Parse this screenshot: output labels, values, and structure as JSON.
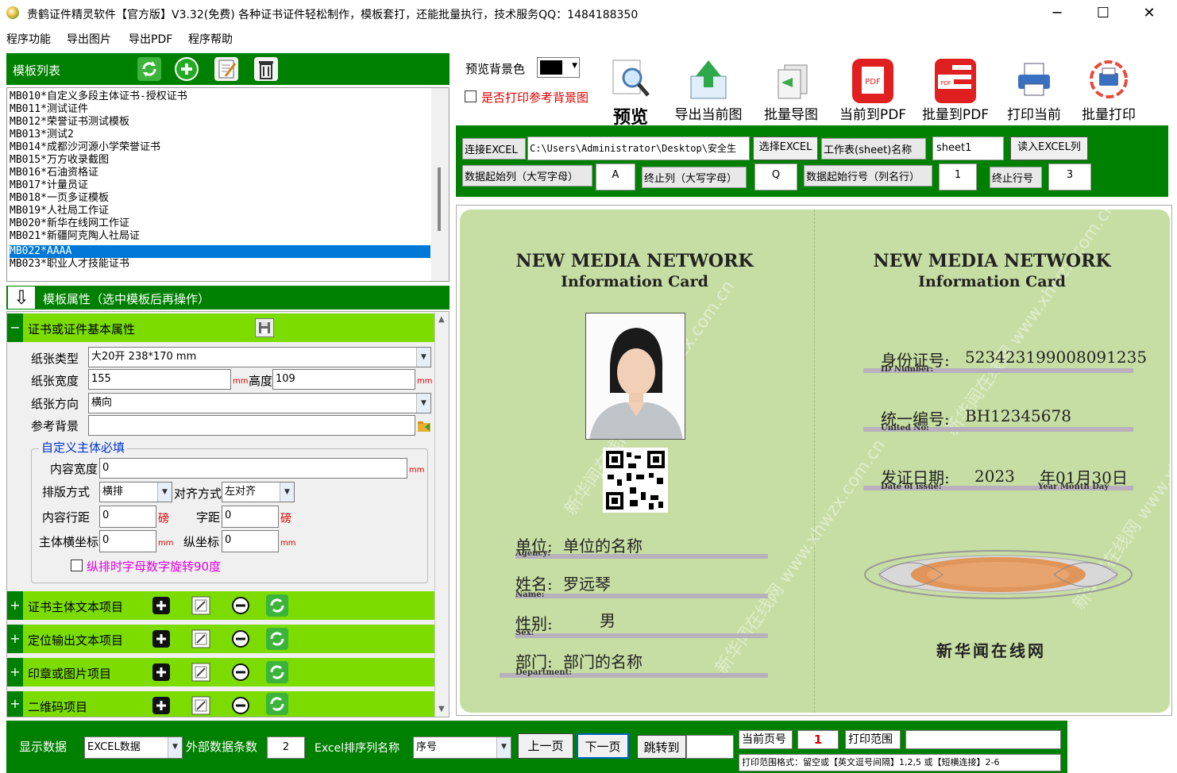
{
  "window": {
    "title": "贵鹤证件精灵软件【官方版】V3.32(免费)    各种证书证件轻松制作，模板套打，还能批量执行，技术服务QQ：1484188350",
    "minimize": "─",
    "maximize": "☐",
    "close": "✕"
  },
  "menu": [
    "程序功能",
    "导出图片",
    "导出PDF",
    "程序帮助"
  ],
  "template_list": {
    "title": "模板列表",
    "items": [
      "MB010*自定义多段主体证书-授权证书",
      "MB011*测试证件",
      "MB012*荣誉证书测试模板",
      "MB013*测试2",
      "MB014*成都沙河源小学荣誉证书",
      "MB015*万方收录截图",
      "MB016*石油资格证",
      "MB017*计量员证",
      "MB018*一页多证模板",
      "MB019*人社局工作证",
      "MB020*新华在线网工作证",
      "MB021*新疆阿克陶人社局证",
      "MB022*AAAA",
      "MB023*职业人才技能证书"
    ],
    "selected_index": 12
  },
  "props": {
    "header": "模板属性（选中模板后再操作）",
    "basic_section": "证书或证件基本属性",
    "paper_type_label": "纸张类型",
    "paper_type_value": "大20开 238*170 mm",
    "width_label": "纸张宽度",
    "width_value": "155",
    "height_label": "高度",
    "height_value": "109",
    "unit_mm": "mm",
    "orientation_label": "纸张方向",
    "orientation_value": "横向",
    "ref_bg_label": "参考背景",
    "ref_bg_value": "",
    "custom_group_title": "自定义主体必填",
    "content_width_label": "内容宽度",
    "content_width_value": "0",
    "layout_label": "排版方式",
    "layout_value": "横排",
    "align_label": "对齐方式",
    "align_value": "左对齐",
    "line_spacing_label": "内容行距",
    "line_spacing_value": "0",
    "unit_pound": "磅",
    "char_spacing_label": "字距",
    "char_spacing_value": "0",
    "x_label": "主体横坐标",
    "x_value": "0",
    "y_label": "纵坐标",
    "y_value": "0",
    "rotate_label": "纵排时字母数字旋转90度",
    "sections": [
      "证书主体文本项目",
      "定位输出文本项目",
      "印章或图片项目",
      "二维码项目"
    ]
  },
  "toolbar": {
    "bg_color_label": "预览背景色",
    "print_ref_label": "是否打印参考背景图",
    "buttons": [
      "预览",
      "导出当前图",
      "批量导图",
      "当前到PDF",
      "批量到PDF",
      "打印当前",
      "批量打印"
    ]
  },
  "excel": {
    "connect_label": "连接EXCEL",
    "path": "C:\\Users\\Administrator\\Desktop\\安全生",
    "select_btn": "选择EXCEL",
    "sheet_label": "工作表(sheet)名称",
    "sheet_value": "sheet1",
    "read_btn": "读入EXCEL列",
    "start_col_label": "数据起始列（大写字母）",
    "start_col_value": "A",
    "end_col_label": "终止列（大写字母）",
    "end_col_value": "Q",
    "start_row_label": "数据起始行号（列名行）",
    "start_row_value": "1",
    "end_row_label": "终止行号",
    "end_row_value": "3"
  },
  "card": {
    "title_en": "NEW MEDIA NETWORK",
    "subtitle_en": "Information Card",
    "watermark": "新华闻在线网 www.xhwzx.com.cn",
    "unit_label": "单位:",
    "unit_value": "单位的名称",
    "unit_sub": "Agency:",
    "name_label": "姓名:",
    "name_value": "罗远琴",
    "name_sub": "Name:",
    "sex_label": "性别:",
    "sex_value": "男",
    "sex_sub": "Sex:",
    "dept_label": "部门:",
    "dept_value": "部门的名称",
    "dept_sub": "Department:",
    "id_label": "身份证号:",
    "id_value": "523423199008091235",
    "id_sub": "ID Number:",
    "uid_label": "统一编号:",
    "uid_value": "BH12345678",
    "uid_sub": "United No:",
    "date_label": "发证日期:",
    "date_year": "2023",
    "date_rest": "年01月30日",
    "date_sub": "Date of issue:",
    "date_sub2": "Year  Month  Day",
    "org": "新华闻在线网"
  },
  "bottom": {
    "display_label": "显示数据",
    "display_value": "EXCEL数据",
    "count_label": "外部数据条数",
    "count_value": "2",
    "sort_label": "Excel排序列名称",
    "sort_value": "序号",
    "prev_btn": "上一页",
    "next_btn": "下一页",
    "jump_btn": "跳转到",
    "jump_value": "",
    "cur_page_label": "当前页号",
    "cur_page_value": "1",
    "print_range_label": "打印范围",
    "print_range_value": "",
    "hint": "打印范围格式：留空或【英文逗号间隔】1,2,5 或【短横连接】2-6"
  },
  "colors": {
    "dark_green": "#008000",
    "light_green": "#7cdc00",
    "card_bg": "#c6dea3",
    "selection": "#0078d7"
  }
}
